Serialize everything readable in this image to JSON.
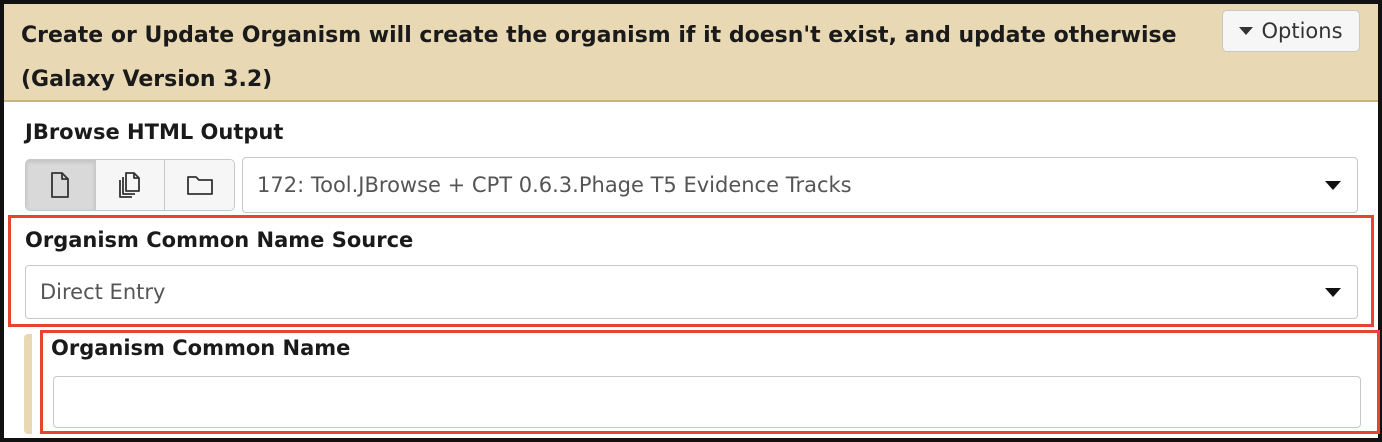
{
  "header": {
    "title": "Create or Update Organism will create the organism if it doesn't exist, and update otherwise (Galaxy Version 3.2)",
    "options_label": "Options"
  },
  "jbrowse_output": {
    "label": "JBrowse HTML Output",
    "source_buttons": [
      {
        "icon": "file-icon",
        "active": true
      },
      {
        "icon": "files-icon",
        "active": false
      },
      {
        "icon": "folder-icon",
        "active": false
      }
    ],
    "selected": "172: Tool.JBrowse + CPT 0.6.3.Phage T5 Evidence Tracks"
  },
  "common_name_source": {
    "label": "Organism Common Name Source",
    "selected": "Direct Entry"
  },
  "common_name": {
    "label": "Organism Common Name",
    "value": "",
    "placeholder": ""
  },
  "colors": {
    "header_bg": "#e8d9b4",
    "highlight": "#e8432e"
  }
}
